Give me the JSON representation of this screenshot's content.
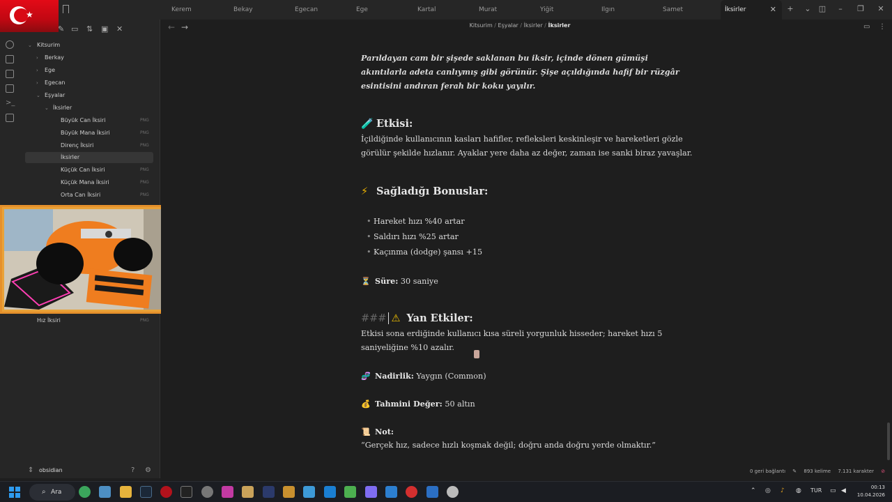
{
  "tabs": [
    {
      "label": "Kerem"
    },
    {
      "label": "Bekay"
    },
    {
      "label": "Egecan"
    },
    {
      "label": "Ege"
    },
    {
      "label": "Kartal"
    },
    {
      "label": "Murat"
    },
    {
      "label": "Yiğit"
    },
    {
      "label": "Ilgın"
    },
    {
      "label": "Samet"
    },
    {
      "label": "İksirler",
      "active": true
    }
  ],
  "sidebar": {
    "tree": [
      {
        "label": "Kitsurim",
        "level": 0,
        "expanded": true
      },
      {
        "label": "Berkay",
        "level": 1
      },
      {
        "label": "Ege",
        "level": 1
      },
      {
        "label": "Egecan",
        "level": 1
      },
      {
        "label": "Eşyalar",
        "level": 1,
        "expanded": true
      },
      {
        "label": "İksirler",
        "level": 2,
        "expanded": true
      },
      {
        "label": "Büyük Can İksiri",
        "level": 3,
        "ext": "PNG"
      },
      {
        "label": "Büyük Mana İksiri",
        "level": 3,
        "ext": "PNG"
      },
      {
        "label": "Direnç İksiri",
        "level": 3,
        "ext": "PNG"
      },
      {
        "label": "İksirler",
        "level": 3,
        "active": true
      },
      {
        "label": "Küçük Can İksiri",
        "level": 3,
        "ext": "PNG"
      },
      {
        "label": "Küçük Mana İksiri",
        "level": 3,
        "ext": "PNG"
      },
      {
        "label": "Orta Can İksiri",
        "level": 3,
        "ext": "PNG"
      },
      {
        "label": "Hız İksiri",
        "level": 1,
        "ext": "PNG"
      }
    ],
    "vault_name": "obsidian"
  },
  "breadcrumb": {
    "items": [
      "Kitsurim",
      "Eşyalar",
      "İksirler"
    ],
    "current": "İksirler"
  },
  "document": {
    "intro": "Parıldayan cam bir şişede saklanan bu iksir, içinde dönen gümüşi akıntılarla adeta canlıymış gibi görünür. Şişe açıldığında hafif bir rüzgâr esintisini andıran ferah bir koku yayılır.",
    "effect_heading": "Etkisi:",
    "effect_text": "İçildiğinde kullanıcının kasları hafifler, refleksleri keskinleşir ve hareketleri gözle görülür şekilde hızlanır. Ayaklar yere daha az değer, zaman ise sanki biraz yavaşlar.",
    "bonus_heading": "Sağladığı Bonuslar:",
    "bonuses": [
      "Hareket hızı %40 artar",
      "Saldırı hızı %25 artar",
      "Kaçınma (dodge) şansı +15"
    ],
    "duration_label": "Süre:",
    "duration_value": "30 saniye",
    "side_hashes": "###",
    "side_heading": "Yan Etkiler:",
    "side_text": "Etkisi sona erdiğinde kullanıcı kısa süreli yorgunluk hisseder; hareket hızı 5 saniyeliğine %10 azalır.",
    "rarity_label": "Nadirlik:",
    "rarity_value": "Yaygın (Common)",
    "value_label": "Tahmini Değer:",
    "value_value": "50 altın",
    "note_label": "Not:",
    "note_text": "“Gerçek hız, sadece hızlı koşmak değil; doğru anda doğru yerde olmaktır.”"
  },
  "status": {
    "backlinks": "0 geri bağlantı",
    "words": "893 kelime",
    "chars": "7.131 karakter"
  },
  "taskbar": {
    "search_label": "Ara",
    "lang": "TUR",
    "time": "00:13",
    "date": "10.04.2026"
  },
  "icons": {
    "emoji_effect": "🧪",
    "emoji_bonus": "⚡",
    "emoji_duration": "⏳",
    "emoji_side": "⚠",
    "emoji_rarity": "🧬",
    "emoji_value": "💰",
    "emoji_note": "📜"
  },
  "colors": {
    "accent": "#7f6df2",
    "flag_red": "#e30a17",
    "webcam_border": "#e5902b"
  }
}
